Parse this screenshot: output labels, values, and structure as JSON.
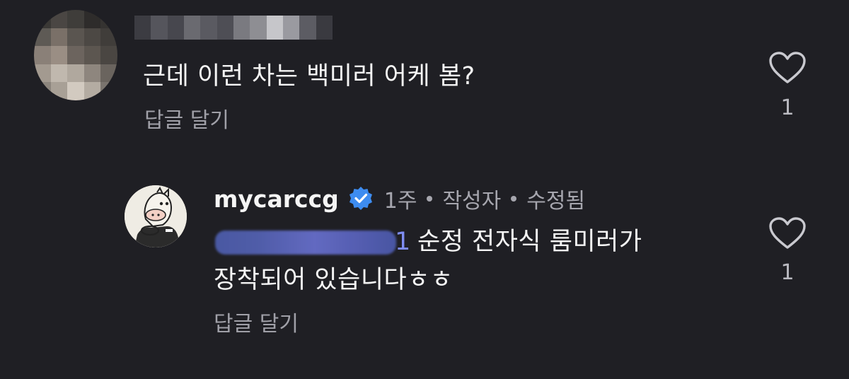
{
  "colors": {
    "background": "#1f1f24",
    "text_primary": "#f5f5f5",
    "text_secondary": "#a0a0a8",
    "mention": "#7f8df2",
    "verified": "#3d8cf0"
  },
  "comments": [
    {
      "username_redacted": true,
      "avatar_redacted": true,
      "text": "근데 이런 차는 백미러 어케 봄?",
      "reply_label": "답글 달기",
      "like_icon": "heart-outline-icon",
      "likes": "1"
    },
    {
      "username": "mycarccg",
      "verified_icon": "verified-badge-icon",
      "time": "1주",
      "author_tag": "작성자",
      "edited_tag": "수정됨",
      "mention_visible_tail": "1",
      "text_line1": "순정 전자식 룸미러가",
      "text_line2": "장착되어 있습니다ㅎㅎ",
      "reply_label": "답글 달기",
      "like_icon": "heart-outline-icon",
      "likes": "1"
    }
  ]
}
